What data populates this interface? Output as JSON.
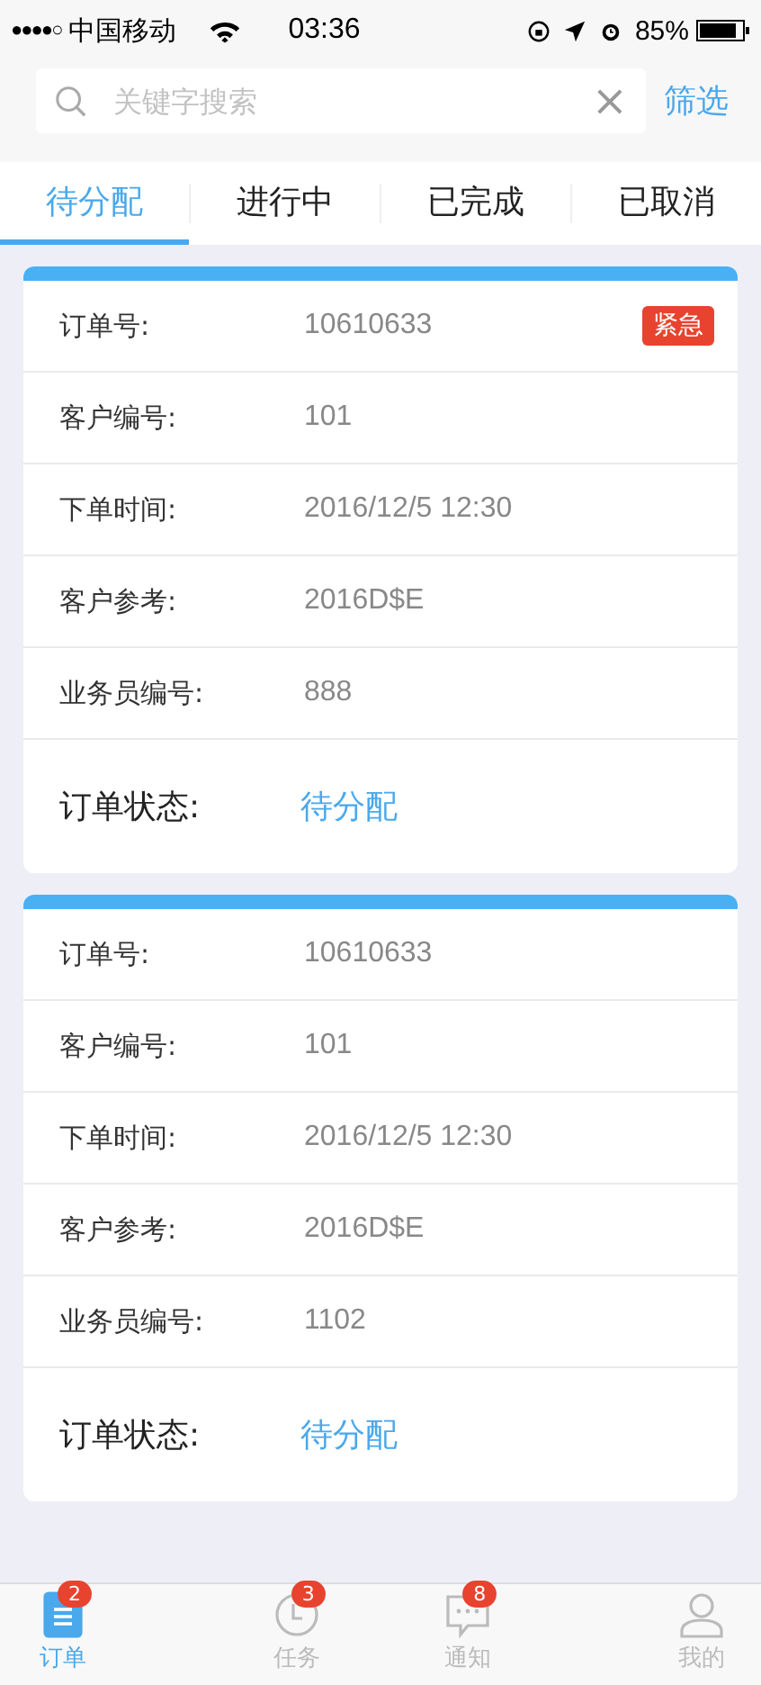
{
  "status_bar": {
    "signal": "●●●●○",
    "carrier": "中国移动",
    "time": "03:36",
    "battery": "85%"
  },
  "search": {
    "placeholder": "关键字搜索",
    "clear": "×",
    "filter": "筛选"
  },
  "tabs": [
    {
      "label": "待分配",
      "selected": true
    },
    {
      "label": "进行中",
      "selected": false
    },
    {
      "label": "已完成",
      "selected": false
    },
    {
      "label": "已取消",
      "selected": false
    }
  ],
  "orders": [
    {
      "urgent_tag": "紧急",
      "fields": [
        {
          "label": "订单号:",
          "value": "10610633"
        },
        {
          "label": "客户编号:",
          "value": "101"
        },
        {
          "label": "下单时间:",
          "value": "2016/12/5   12:30"
        },
        {
          "label": "客户参考:",
          "value": "2016D$E"
        },
        {
          "label": "业务员编号:",
          "value": "888"
        }
      ],
      "status_label": "订单状态:",
      "status": "待分配"
    },
    {
      "fields": [
        {
          "label": "订单号:",
          "value": "10610633"
        },
        {
          "label": "客户编号:",
          "value": "101"
        },
        {
          "label": "下单时间:",
          "value": "2016/12/5   12:30"
        },
        {
          "label": "客户参考:",
          "value": "2016D$E"
        },
        {
          "label": "业务员编号:",
          "value": "1102"
        }
      ],
      "status_label": "订单状态:",
      "status": "待分配"
    }
  ],
  "bottom_nav": [
    {
      "kind": "document",
      "label": "订单",
      "badge": "2",
      "selected": true
    },
    {
      "kind": "clock",
      "label": "任务",
      "badge": "3",
      "selected": false
    },
    {
      "kind": "chat",
      "label": "通知",
      "badge": "8",
      "selected": false
    },
    {
      "kind": "person",
      "label": "我的",
      "selected": false
    }
  ]
}
